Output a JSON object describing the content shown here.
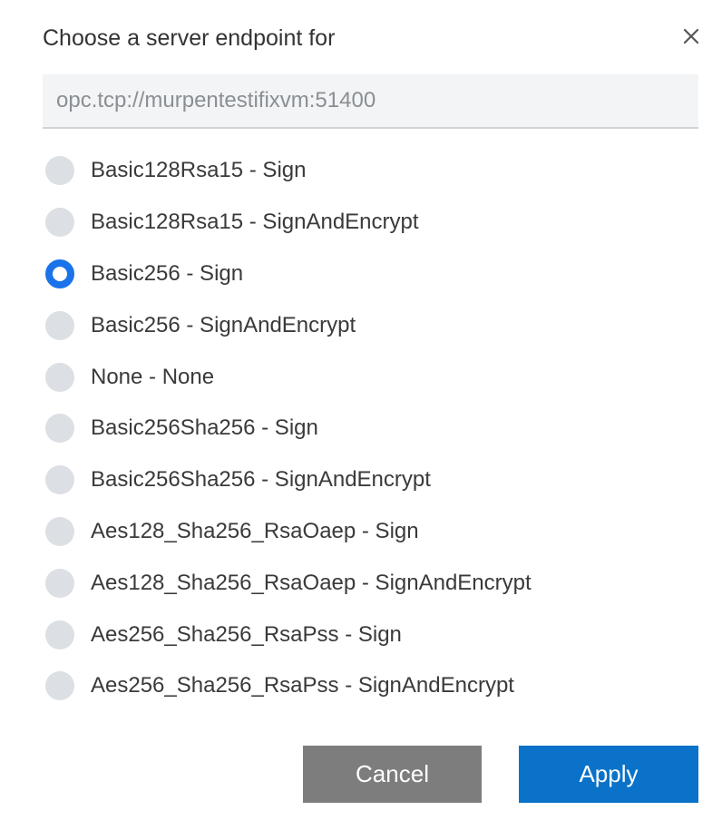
{
  "dialog": {
    "title": "Choose a server endpoint for",
    "close_icon": "close-icon"
  },
  "url_field": {
    "value": "opc.tcp://murpentestifixvm:51400"
  },
  "options": [
    {
      "label": "Basic128Rsa15 - Sign",
      "selected": false
    },
    {
      "label": "Basic128Rsa15 - SignAndEncrypt",
      "selected": false
    },
    {
      "label": "Basic256 - Sign",
      "selected": true
    },
    {
      "label": "Basic256 - SignAndEncrypt",
      "selected": false
    },
    {
      "label": "None - None",
      "selected": false
    },
    {
      "label": "Basic256Sha256 - Sign",
      "selected": false
    },
    {
      "label": "Basic256Sha256 - SignAndEncrypt",
      "selected": false
    },
    {
      "label": "Aes128_Sha256_RsaOaep - Sign",
      "selected": false
    },
    {
      "label": "Aes128_Sha256_RsaOaep - SignAndEncrypt",
      "selected": false
    },
    {
      "label": "Aes256_Sha256_RsaPss - Sign",
      "selected": false
    },
    {
      "label": "Aes256_Sha256_RsaPss - SignAndEncrypt",
      "selected": false
    }
  ],
  "buttons": {
    "cancel_label": "Cancel",
    "apply_label": "Apply"
  },
  "colors": {
    "accent": "#1a73e8",
    "apply_bg": "#0a73c9",
    "cancel_bg": "#7d7d7d",
    "radio_unselected": "#dcdfe3"
  }
}
